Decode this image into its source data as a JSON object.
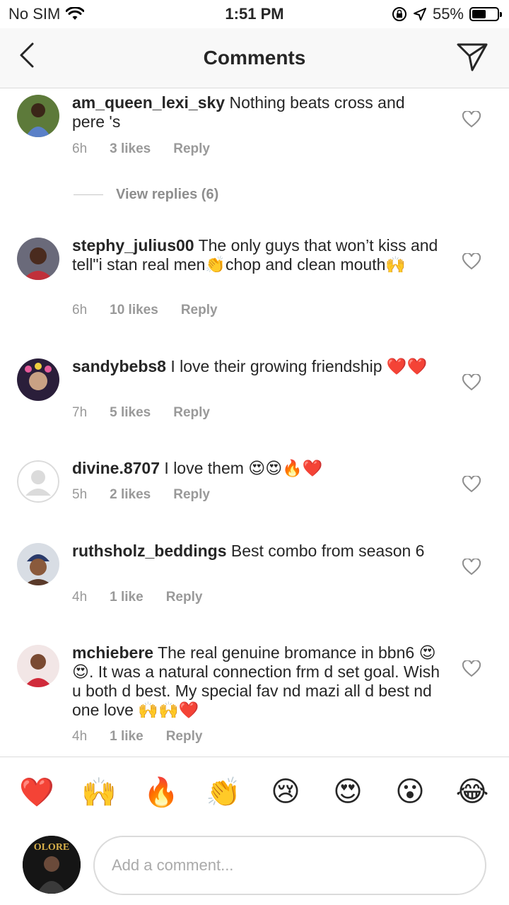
{
  "status_bar": {
    "carrier": "No SIM",
    "time": "1:51 PM",
    "battery": "55%",
    "battery_level": 0.55
  },
  "header": {
    "title": "Comments"
  },
  "comments": [
    {
      "username": "am_queen_lexi_sky",
      "text": "Nothing beats cross and pere 's",
      "time": "6h",
      "likes": "3 likes",
      "reply": "Reply"
    },
    {
      "username": "stephy_julius00",
      "text": "The only guys that won’t kiss and tell\"i stan real men👏chop and clean mouth🙌",
      "time": "6h",
      "likes": "10 likes",
      "reply": "Reply"
    },
    {
      "username": "sandybebs8",
      "text": "I love their growing friendship ❤️❤️",
      "time": "7h",
      "likes": "5 likes",
      "reply": "Reply"
    },
    {
      "username": "divine.8707",
      "text": "I love  them 😍😍🔥❤️",
      "time": "5h",
      "likes": "2 likes",
      "reply": "Reply"
    },
    {
      "username": "ruthsholz_beddings",
      "text": "Best combo from season 6",
      "time": "4h",
      "likes": "1 like",
      "reply": "Reply"
    },
    {
      "username": "mchiebere",
      "text": "The real genuine bromance in bbn6 😍😍. It was a natural connection frm d set goal. Wish u both d best. My special fav nd mazi all d best nd one love 🙌🙌❤️",
      "time": "4h",
      "likes": "1 like",
      "reply": "Reply"
    }
  ],
  "view_replies": "View replies (6)",
  "quick_emojis": [
    "❤️",
    "🙌",
    "🔥",
    "👏",
    "😢",
    "😍",
    "😮",
    "😂"
  ],
  "composer": {
    "placeholder": "Add a comment...",
    "avatar_text": "OLORE"
  }
}
